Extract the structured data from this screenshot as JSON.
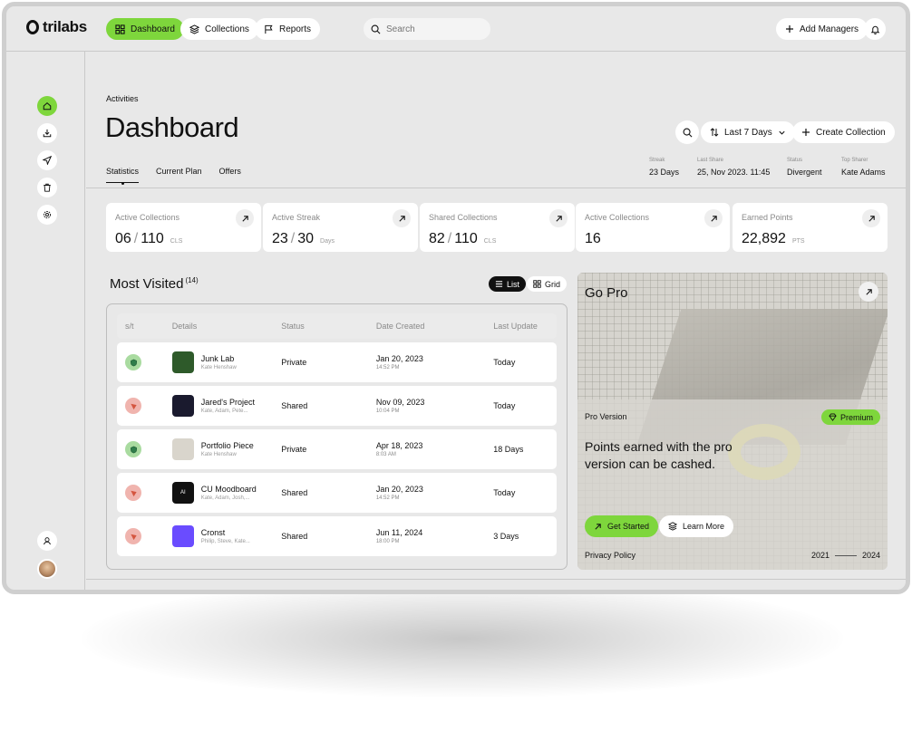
{
  "brand": {
    "name": "trilabs"
  },
  "nav": {
    "items": [
      {
        "label": "Dashboard",
        "icon": "grid-icon",
        "active": true
      },
      {
        "label": "Collections",
        "icon": "layers-icon",
        "active": false
      },
      {
        "label": "Reports",
        "icon": "flag-icon",
        "active": false
      }
    ],
    "search_placeholder": "Search",
    "add_managers_label": "Add Managers"
  },
  "sidebar": {
    "items": [
      {
        "icon": "home-icon",
        "active": true
      },
      {
        "icon": "download-icon",
        "active": false
      },
      {
        "icon": "send-icon",
        "active": false
      },
      {
        "icon": "trash-icon",
        "active": false
      },
      {
        "icon": "gear-icon",
        "active": false
      }
    ],
    "bottom_icon": "support-icon"
  },
  "page": {
    "breadcrumb": "Activities",
    "title": "Dashboard",
    "range_label": "Last 7 Days",
    "create_label": "Create Collection",
    "tabs": [
      {
        "label": "Statistics",
        "active": true
      },
      {
        "label": "Current Plan",
        "active": false
      },
      {
        "label": "Offers",
        "active": false
      }
    ]
  },
  "meta": [
    {
      "key": "Streak",
      "value": "23 Days"
    },
    {
      "key": "Last Share",
      "value": "25, Nov 2023. 11:45"
    },
    {
      "key": "Status",
      "value": "Divergent"
    },
    {
      "key": "Top Sharer",
      "value": "Kate Adams"
    }
  ],
  "stats": [
    {
      "label": "Active Collections",
      "value": "06",
      "total": "110",
      "unit": "CLS"
    },
    {
      "label": "Active Streak",
      "value": "23",
      "total": "30",
      "unit": "Days"
    },
    {
      "label": "Shared Collections",
      "value": "82",
      "total": "110",
      "unit": "CLS"
    },
    {
      "label": "Active Collections",
      "value": "16",
      "total": "",
      "unit": ""
    },
    {
      "label": "Earned Points",
      "value": "22,892",
      "total": "",
      "unit": "PTS"
    }
  ],
  "most_visited": {
    "title": "Most Visited",
    "count": "(14)",
    "view_list": "List",
    "view_grid": "Grid",
    "columns": [
      "s/t",
      "Details",
      "Status",
      "Date Created",
      "Last Update"
    ],
    "rows": [
      {
        "kind": "private",
        "name": "Junk Lab",
        "people": "Kate Henshaw",
        "status": "Private",
        "date": "Jan 20, 2023",
        "time": "14:52 PM",
        "updated": "Today",
        "thumb_color": "#2e5a2a"
      },
      {
        "kind": "shared",
        "name": "Jared's Project",
        "people": "Kate, Adam, Pete...",
        "status": "Shared",
        "date": "Nov 09, 2023",
        "time": "10:04 PM",
        "updated": "Today",
        "thumb_color": "#1a1a2e"
      },
      {
        "kind": "private",
        "name": "Portfolio Piece",
        "people": "Kate Henshaw",
        "status": "Private",
        "date": "Apr 18, 2023",
        "time": "8:03 AM",
        "updated": "18 Days",
        "thumb_color": "#d9d5cc"
      },
      {
        "kind": "shared",
        "name": "CU Moodboard",
        "people": "Kate, Adam, Josh,...",
        "status": "Shared",
        "date": "Jan 20, 2023",
        "time": "14:52 PM",
        "updated": "Today",
        "thumb_color": "#111111",
        "thumb_text": "AI"
      },
      {
        "kind": "shared",
        "name": "Cronst",
        "people": "Philip, Steve, Kate...",
        "status": "Shared",
        "date": "Jun 11, 2024",
        "time": "18:00 PM",
        "updated": "3 Days",
        "thumb_color": "#6a4cff"
      }
    ]
  },
  "promo": {
    "title": "Go Pro",
    "version_label": "Pro Version",
    "badge": "Premium",
    "headline": "Points earned with the pro version can be cashed.",
    "cta_primary": "Get Started",
    "cta_secondary": "Learn More",
    "privacy": "Privacy Policy",
    "year_start": "2021",
    "year_end": "2024"
  },
  "colors": {
    "accent": "#7ed63c",
    "private": "#a9dba0",
    "shared": "#f0b4ae"
  }
}
